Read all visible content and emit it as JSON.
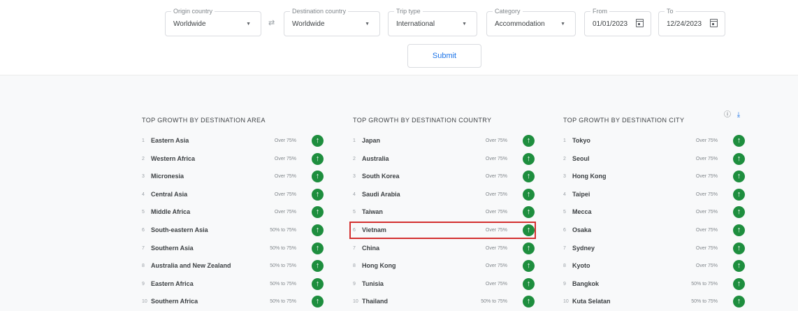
{
  "filters": {
    "origin_country": {
      "label": "Origin country",
      "value": "Worldwide"
    },
    "destination_country": {
      "label": "Destination country",
      "value": "Worldwide"
    },
    "trip_type": {
      "label": "Trip type",
      "value": "International"
    },
    "category": {
      "label": "Category",
      "value": "Accommodation"
    },
    "from": {
      "label": "From",
      "value": "01/01/2023"
    },
    "to": {
      "label": "To",
      "value": "12/24/2023"
    },
    "swap_icon": "swap-arrows-icon",
    "submit_label": "Submit"
  },
  "colors": {
    "accent": "#1a73e8",
    "growth_badge": "#1e8e3e",
    "highlight": "#d32f2f",
    "results_bg": "#f8f9fa"
  },
  "icons": {
    "help": "help-circle-icon",
    "download": "download-icon",
    "arrow": "arrow-up-icon",
    "dropdown": "dropdown-caret-icon",
    "calendar": "calendar-icon"
  },
  "areas": {
    "title": "TOP GROWTH BY DESTINATION AREA",
    "rows": [
      {
        "rank": "1",
        "name": "Eastern Asia",
        "growth": "Over 75%"
      },
      {
        "rank": "2",
        "name": "Western Africa",
        "growth": "Over 75%"
      },
      {
        "rank": "3",
        "name": "Micronesia",
        "growth": "Over 75%"
      },
      {
        "rank": "4",
        "name": "Central Asia",
        "growth": "Over 75%"
      },
      {
        "rank": "5",
        "name": "Middle Africa",
        "growth": "Over 75%"
      },
      {
        "rank": "6",
        "name": "South-eastern Asia",
        "growth": "50% to 75%"
      },
      {
        "rank": "7",
        "name": "Southern Asia",
        "growth": "50% to 75%"
      },
      {
        "rank": "8",
        "name": "Australia and New Zealand",
        "growth": "50% to 75%"
      },
      {
        "rank": "9",
        "name": "Eastern Africa",
        "growth": "50% to 75%"
      },
      {
        "rank": "10",
        "name": "Southern Africa",
        "growth": "50% to 75%"
      }
    ]
  },
  "countries": {
    "title": "TOP GROWTH BY DESTINATION COUNTRY",
    "rows": [
      {
        "rank": "1",
        "name": "Japan",
        "growth": "Over 75%"
      },
      {
        "rank": "2",
        "name": "Australia",
        "growth": "Over 75%"
      },
      {
        "rank": "3",
        "name": "South Korea",
        "growth": "Over 75%"
      },
      {
        "rank": "4",
        "name": "Saudi Arabia",
        "growth": "Over 75%"
      },
      {
        "rank": "5",
        "name": "Taiwan",
        "growth": "Over 75%"
      },
      {
        "rank": "6",
        "name": "Vietnam",
        "growth": "Over 75%"
      },
      {
        "rank": "7",
        "name": "China",
        "growth": "Over 75%"
      },
      {
        "rank": "8",
        "name": "Hong Kong",
        "growth": "Over 75%"
      },
      {
        "rank": "9",
        "name": "Tunisia",
        "growth": "Over 75%"
      },
      {
        "rank": "10",
        "name": "Thailand",
        "growth": "50% to 75%"
      }
    ]
  },
  "cities": {
    "title": "TOP GROWTH BY DESTINATION CITY",
    "rows": [
      {
        "rank": "1",
        "name": "Tokyo",
        "growth": "Over 75%"
      },
      {
        "rank": "2",
        "name": "Seoul",
        "growth": "Over 75%"
      },
      {
        "rank": "3",
        "name": "Hong Kong",
        "growth": "Over 75%"
      },
      {
        "rank": "4",
        "name": "Taipei",
        "growth": "Over 75%"
      },
      {
        "rank": "5",
        "name": "Mecca",
        "growth": "Over 75%"
      },
      {
        "rank": "6",
        "name": "Osaka",
        "growth": "Over 75%"
      },
      {
        "rank": "7",
        "name": "Sydney",
        "growth": "Over 75%"
      },
      {
        "rank": "8",
        "name": "Kyoto",
        "growth": "Over 75%"
      },
      {
        "rank": "9",
        "name": "Bangkok",
        "growth": "50% to 75%"
      },
      {
        "rank": "10",
        "name": "Kuta Selatan",
        "growth": "50% to 75%"
      }
    ]
  }
}
